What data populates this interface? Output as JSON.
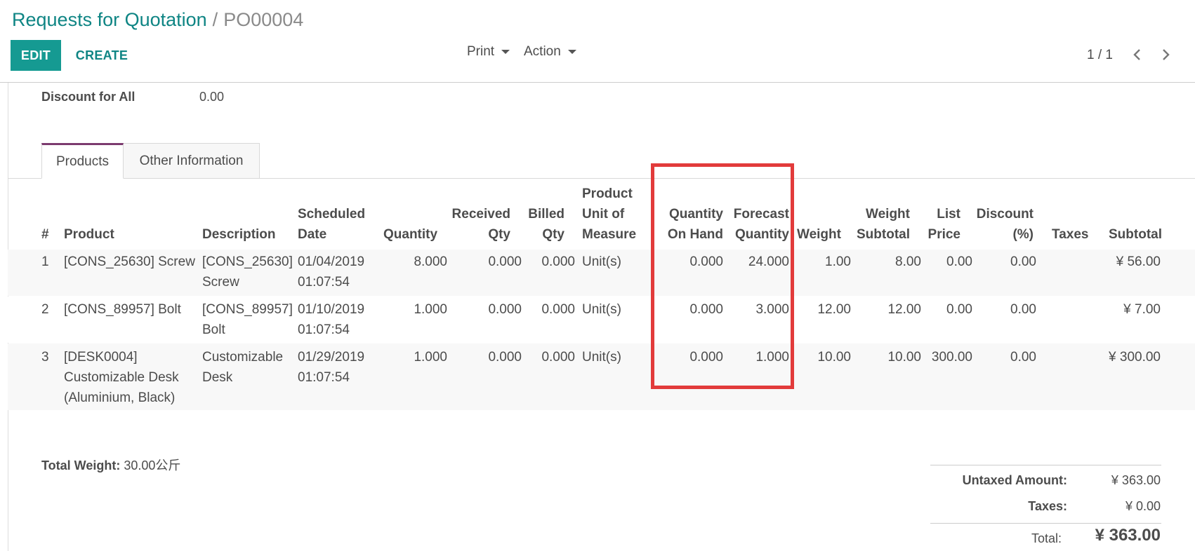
{
  "breadcrumb": {
    "parent": "Requests for Quotation",
    "separator": "/",
    "current": "PO00004"
  },
  "buttons": {
    "edit": "EDIT",
    "create": "CREATE"
  },
  "menus": {
    "print": "Print",
    "action": "Action"
  },
  "pager": {
    "value": "1 / 1"
  },
  "discount": {
    "label": "Discount for All",
    "value": "0.00"
  },
  "tabs": {
    "products": "Products",
    "other": "Other Information"
  },
  "columns": {
    "num": "#",
    "product": "Product",
    "description": "Description",
    "scheduled": [
      "Scheduled",
      "Date"
    ],
    "quantity": "Quantity",
    "received": [
      "Received",
      "Qty"
    ],
    "billed": [
      "Billed",
      "Qty"
    ],
    "uom": [
      "Product",
      "Unit of",
      "Measure"
    ],
    "on_hand": [
      "Quantity",
      "On Hand"
    ],
    "forecast": [
      "Forecast",
      "Quantity"
    ],
    "weight": "Weight",
    "weight_subtotal": [
      "Weight",
      "Subtotal"
    ],
    "list_price": [
      "List",
      "Price"
    ],
    "discount": [
      "Discount",
      "(%)"
    ],
    "taxes": "Taxes",
    "subtotal": "Subtotal"
  },
  "rows": [
    {
      "num": "1",
      "product": [
        "[CONS_25630] Screw"
      ],
      "description": [
        "[CONS_25630]",
        "Screw"
      ],
      "scheduled": [
        "01/04/2019",
        "01:07:54"
      ],
      "quantity": "8.000",
      "received": "0.000",
      "billed": "0.000",
      "uom": "Unit(s)",
      "on_hand": "0.000",
      "forecast": "24.000",
      "weight": "1.00",
      "weight_subtotal": "8.00",
      "list_price": "0.00",
      "discount": "0.00",
      "taxes": "",
      "subtotal": "¥ 56.00"
    },
    {
      "num": "2",
      "product": [
        "[CONS_89957] Bolt"
      ],
      "description": [
        "[CONS_89957]",
        "Bolt"
      ],
      "scheduled": [
        "01/10/2019",
        "01:07:54"
      ],
      "quantity": "1.000",
      "received": "0.000",
      "billed": "0.000",
      "uom": "Unit(s)",
      "on_hand": "0.000",
      "forecast": "3.000",
      "weight": "12.00",
      "weight_subtotal": "12.00",
      "list_price": "0.00",
      "discount": "0.00",
      "taxes": "",
      "subtotal": "¥ 7.00"
    },
    {
      "num": "3",
      "product": [
        "[DESK0004]",
        "Customizable Desk",
        "(Aluminium, Black)"
      ],
      "description": [
        "Customizable",
        "Desk"
      ],
      "scheduled": [
        "01/29/2019",
        "01:07:54"
      ],
      "quantity": "1.000",
      "received": "0.000",
      "billed": "0.000",
      "uom": "Unit(s)",
      "on_hand": "0.000",
      "forecast": "1.000",
      "weight": "10.00",
      "weight_subtotal": "10.00",
      "list_price": "300.00",
      "discount": "0.00",
      "taxes": "",
      "subtotal": "¥ 300.00"
    }
  ],
  "total_weight": {
    "label": "Total Weight:",
    "value": "30.00公斤"
  },
  "totals": {
    "untaxed_label": "Untaxed Amount:",
    "untaxed_value": "¥ 363.00",
    "taxes_label": "Taxes:",
    "taxes_value": "¥ 0.00",
    "total_label": "Total:",
    "total_value": "¥ 363.00"
  },
  "colors": {
    "accent": "#159a92",
    "link": "#0f8584",
    "tab_accent": "#7c3b6f",
    "highlight": "#e23b3b"
  }
}
